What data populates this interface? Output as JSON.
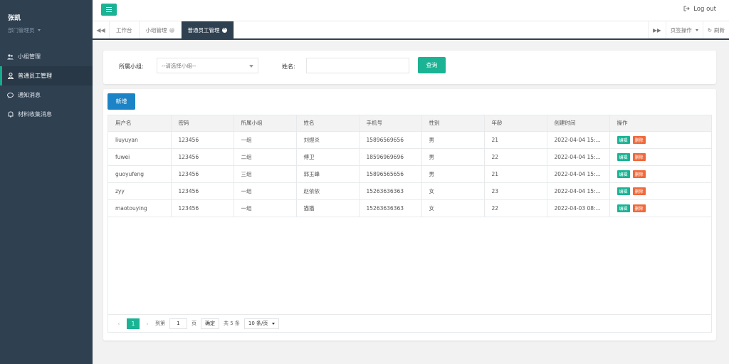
{
  "sidebar": {
    "user_name": "张凯",
    "user_role": "部门管理员",
    "items": [
      {
        "label": "小组管理"
      },
      {
        "label": "普通员工管理"
      },
      {
        "label": "通知消息"
      },
      {
        "label": "材料收集消息"
      }
    ]
  },
  "topbar": {
    "logout": "Log out"
  },
  "tabs": {
    "items": [
      {
        "label": "工作台"
      },
      {
        "label": "小组管理"
      },
      {
        "label": "普通员工管理"
      }
    ],
    "tab_actions": "页签操作",
    "refresh": "刷新"
  },
  "search": {
    "group_label": "所属小组:",
    "group_select": "--请选择小组--",
    "name_label": "姓名:",
    "name_value": "",
    "query_button": "查询"
  },
  "table": {
    "add_button": "新增",
    "columns": [
      "用户名",
      "密码",
      "所属小组",
      "姓名",
      "手机号",
      "性别",
      "年龄",
      "创建时间",
      "操作"
    ],
    "rows": [
      {
        "username": "liuyuyan",
        "password": "123456",
        "group": "一组",
        "name": "刘煜炎",
        "phone": "15896569656",
        "gender": "男",
        "age": "21",
        "created": "2022-04-04 15:..."
      },
      {
        "username": "fuwei",
        "password": "123456",
        "group": "二组",
        "name": "傅卫",
        "phone": "18596969696",
        "gender": "男",
        "age": "22",
        "created": "2022-04-04 15:..."
      },
      {
        "username": "guoyufeng",
        "password": "123456",
        "group": "三组",
        "name": "郭玉峰",
        "phone": "15896565656",
        "gender": "男",
        "age": "21",
        "created": "2022-04-04 15:..."
      },
      {
        "username": "zyy",
        "password": "123456",
        "group": "一组",
        "name": "赵依依",
        "phone": "15263636363",
        "gender": "女",
        "age": "23",
        "created": "2022-04-04 15:..."
      },
      {
        "username": "maotouying",
        "password": "123456",
        "group": "一组",
        "name": "猫猫",
        "phone": "15263636363",
        "gender": "女",
        "age": "22",
        "created": "2022-04-03 08:..."
      }
    ],
    "edit_label": "编辑",
    "delete_label": "删除"
  },
  "pager": {
    "current_page": "1",
    "goto_label": "到第",
    "goto_value": "1",
    "page_unit": "页",
    "confirm": "确定",
    "total": "共 5 条",
    "page_size": "10 条/页"
  },
  "colors": {
    "sidebar_bg": "#2f4050",
    "primary_green": "#1ab394",
    "primary_blue": "#1c84c6",
    "danger_orange": "#f0693b"
  }
}
